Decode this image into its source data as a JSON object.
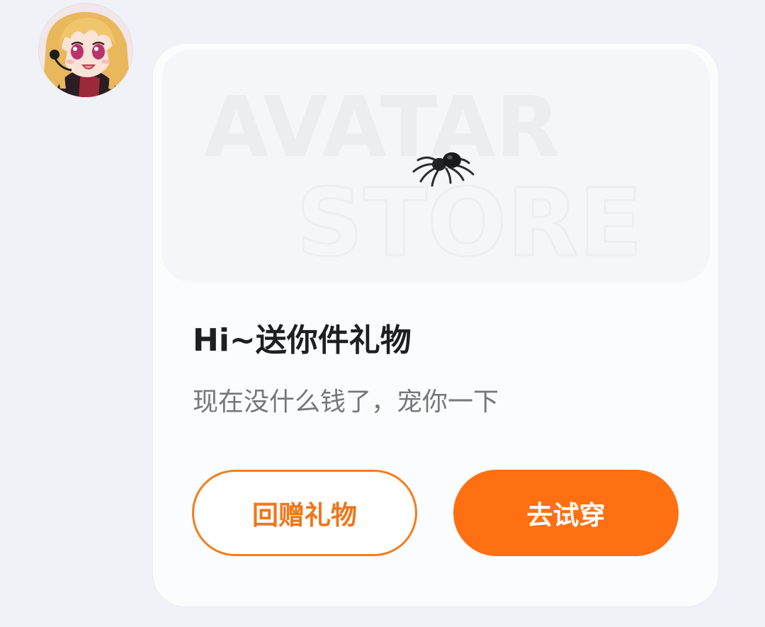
{
  "avatar": {
    "label": "user avatar"
  },
  "banner": {
    "watermark_line1": "AVATAR",
    "watermark_line2": "STORE",
    "gift_icon": "spider-icon"
  },
  "card": {
    "title": "Hi~送你件礼物",
    "subtitle": "现在没什么钱了，宠你一下"
  },
  "actions": {
    "return_gift_label": "回赠礼物",
    "try_on_label": "去试穿"
  },
  "colors": {
    "accent": "#fe7012",
    "accent_outline": "#f37d1f",
    "page_background": "#f1f2f7",
    "card_background": "#fbfcfe"
  }
}
